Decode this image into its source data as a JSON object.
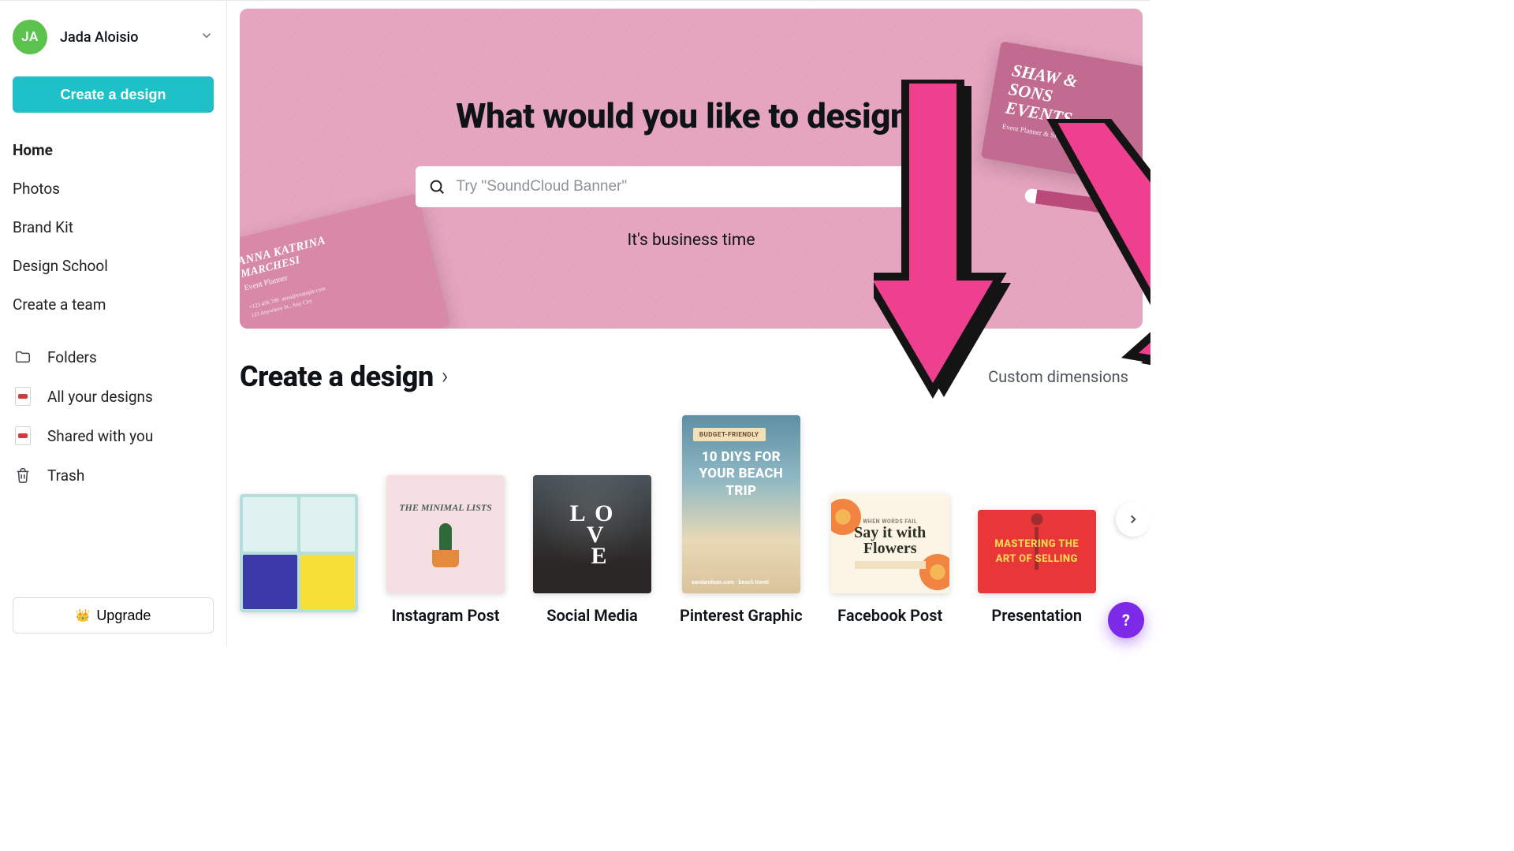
{
  "user": {
    "initials": "JA",
    "name": "Jada Aloisio"
  },
  "sidebar": {
    "create_button": "Create a design",
    "nav": [
      {
        "label": "Home",
        "active": true
      },
      {
        "label": "Photos",
        "active": false
      },
      {
        "label": "Brand Kit",
        "active": false
      },
      {
        "label": "Design School",
        "active": false
      },
      {
        "label": "Create a team",
        "active": false
      }
    ],
    "nav2": [
      {
        "icon": "folder-icon",
        "label": "Folders"
      },
      {
        "icon": "doc-icon",
        "label": "All your designs"
      },
      {
        "icon": "doc-icon",
        "label": "Shared with you"
      },
      {
        "icon": "trash-icon",
        "label": "Trash"
      }
    ],
    "upgrade": "Upgrade"
  },
  "hero": {
    "title": "What would you like to design?",
    "search_placeholder": "Try \"SoundCloud Banner\"",
    "tagline": "It's business time",
    "decor": {
      "left_card_line1": "ANNA KATRINA",
      "left_card_line2": "MARCHESI",
      "left_card_role": "Event Planner",
      "right_card_line1": "SHAW &",
      "right_card_line2": "SONS",
      "right_card_line3": "EVENTS",
      "right_card_sub": "Event Planner & Styling"
    }
  },
  "section": {
    "title": "Create a design",
    "custom_dimensions": "Custom dimensions",
    "types": [
      {
        "label": "",
        "thumb_title": ""
      },
      {
        "label": "Instagram Post",
        "thumb_title": "THE MINIMAL LISTS"
      },
      {
        "label": "Social Media",
        "thumb_title": "LOVE"
      },
      {
        "label": "Pinterest Graphic",
        "thumb_title": "10 DIYS FOR YOUR BEACH TRIP"
      },
      {
        "label": "Facebook Post",
        "thumb_title": "Say it with Flowers"
      },
      {
        "label": "Presentation",
        "thumb_title": "MASTERING THE ART OF SELLING"
      }
    ]
  },
  "help_label": "?"
}
